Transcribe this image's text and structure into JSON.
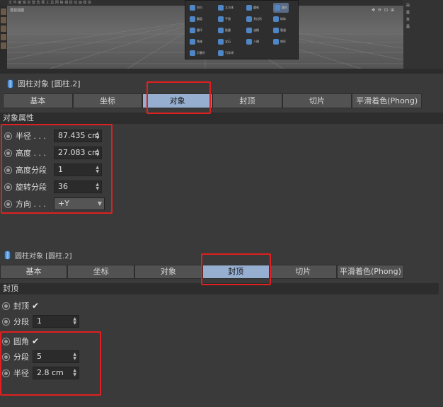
{
  "viewport": {
    "menu_text": "文 件  编 辑  创 建  选 择  工 具  网 格  捕 捉  动 画  模 拟",
    "label": "透视视图",
    "tools": "✥ ⟳ ⊡ ⊞"
  },
  "right_panel": {
    "rows": [
      "白",
      "蓝",
      "灰",
      "黑"
    ]
  },
  "primitive_menu": {
    "items": [
      {
        "label": "空白",
        "icon": "null-icon"
      },
      {
        "label": "立方体",
        "icon": "cube-icon"
      },
      {
        "label": "圆锥",
        "icon": "cone-icon"
      },
      {
        "label": "圆柱",
        "icon": "cylinder-icon",
        "selected": true
      },
      {
        "label": "圆盘",
        "icon": "disc-icon"
      },
      {
        "label": "平面",
        "icon": "plane-icon"
      },
      {
        "label": "多边形",
        "icon": "polygon-icon"
      },
      {
        "label": "球体",
        "icon": "sphere-icon"
      },
      {
        "label": "圆环",
        "icon": "torus-icon"
      },
      {
        "label": "胶囊",
        "icon": "capsule-icon"
      },
      {
        "label": "油桶",
        "icon": "oiltank-icon"
      },
      {
        "label": "管道",
        "icon": "tube-icon"
      },
      {
        "label": "角锥",
        "icon": "pyramid-icon"
      },
      {
        "label": "宝石",
        "icon": "gem-icon"
      },
      {
        "label": "人偶",
        "icon": "figure-icon"
      },
      {
        "label": "地形",
        "icon": "landscape-icon"
      },
      {
        "label": "贝塞尔",
        "icon": "bezier-icon"
      },
      {
        "label": "引导线",
        "icon": "guide-icon"
      }
    ]
  },
  "panel1": {
    "title": "圆柱对象 [圆柱.2]",
    "tabs": [
      "基本",
      "坐标",
      "对象",
      "封顶",
      "切片",
      "平滑着色(Phong)"
    ],
    "section": "对象属性",
    "props": [
      {
        "label": "半径 . . .",
        "value": "87.435 cm"
      },
      {
        "label": "高度 . . .",
        "value": "27.083 cm"
      },
      {
        "label": "高度分段",
        "value": "1"
      },
      {
        "label": "旋转分段",
        "value": "36"
      },
      {
        "label": "方向 . . .",
        "value": "+Y"
      }
    ]
  },
  "panel2": {
    "title": "圆柱对象 [圆柱.2]",
    "tabs": [
      "基本",
      "坐标",
      "对象",
      "封顶",
      "切片",
      "平滑着色(Phong)"
    ],
    "section": "封顶",
    "props": [
      {
        "label": "封顶",
        "check": "✔"
      },
      {
        "label": "分段",
        "value": "1"
      },
      {
        "label": "圆角",
        "check": "✔"
      },
      {
        "label": "分段",
        "value": "5"
      },
      {
        "label": "半径",
        "value": "2.8 cm"
      }
    ]
  },
  "colors": {
    "active_tab": "#96afd0",
    "highlight": "#e02020",
    "icon_blue": "#4f86c6"
  }
}
